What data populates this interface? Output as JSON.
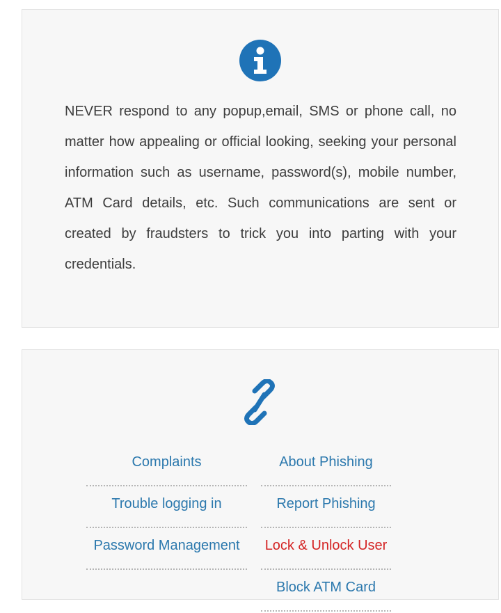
{
  "info_panel": {
    "icon": "info-circle-icon",
    "icon_color": "#1f73b7",
    "notice": "NEVER respond to any popup,email, SMS or phone call, no matter how appealing or official looking, seeking your personal information such as username, password(s), mobile number, ATM Card details, etc. Such communications are sent or created by fraudsters to trick you into parting with your credentials."
  },
  "links_panel": {
    "icon": "link-icon",
    "icon_color": "#1f73b7",
    "left_links": [
      "Complaints",
      "Trouble logging in",
      "Password Management"
    ],
    "right_links": [
      "About Phishing",
      "Report Phishing",
      "Lock & Unlock User",
      "Block ATM Card"
    ],
    "active_link": "Lock & Unlock User",
    "link_color": "#2b78ad",
    "active_color": "#d42424"
  }
}
